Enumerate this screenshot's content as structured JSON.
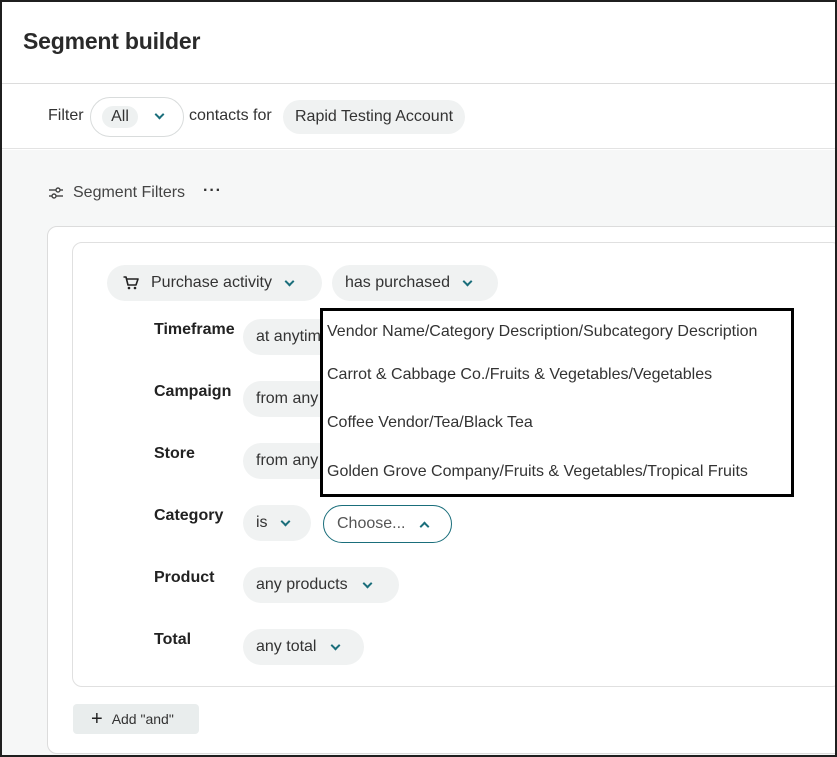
{
  "header": {
    "title": "Segment builder"
  },
  "filter_bar": {
    "filter_label": "Filter",
    "audience_value": "All",
    "contacts_for_label": "contacts for",
    "account_name": "Rapid Testing Account"
  },
  "segment_filters": {
    "title": "Segment Filters",
    "menu_label": "···"
  },
  "condition": {
    "activity_label": "Purchase activity",
    "operator_label": "has purchased",
    "rows": {
      "timeframe": {
        "label": "Timeframe",
        "value": "at anytime"
      },
      "campaign": {
        "label": "Campaign",
        "value": "from any"
      },
      "store": {
        "label": "Store",
        "value": "from any"
      },
      "category": {
        "label": "Category",
        "operator": "is",
        "placeholder": "Choose..."
      },
      "product": {
        "label": "Product",
        "value": "any products"
      },
      "total": {
        "label": "Total",
        "value": "any total"
      }
    }
  },
  "category_dropdown": {
    "options": [
      "Vendor Name/Category Description/Subcategory Description",
      "Carrot & Cabbage Co./Fruits & Vegetables/Vegetables",
      "Coffee Vendor/Tea/Black Tea",
      "Golden Grove Company/Fruits & Vegetables/Tropical Fruits"
    ]
  },
  "add_and": {
    "label": "Add \"and\""
  },
  "colors": {
    "accent": "#1a6e7b",
    "pill_bg": "#f0f2f2",
    "page_bg": "#f6f7f7"
  }
}
